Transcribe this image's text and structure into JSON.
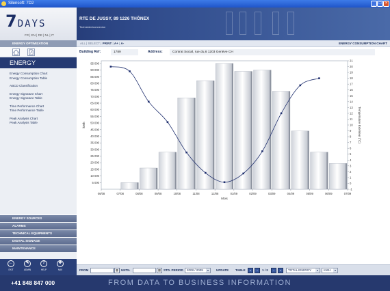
{
  "window": {
    "title": "Silensoft: 7D2"
  },
  "header": {
    "logo_main": "7",
    "logo_days": "DAYS",
    "languages": "FR | EN | DE | NL | IT",
    "address": "RTE DE JUSSY, 89 1226 THÔNEX",
    "subtitle": "Technicien/connexion"
  },
  "toolbar": {
    "section_label": "ENERGY OPTIMIZATION",
    "all": "ALL",
    "select": "SELECT",
    "print": "PRINT",
    "font_up": "A+",
    "font_down": "A-",
    "sep": "|",
    "right_title": "ENERGY CONSUMPTION CHART"
  },
  "sidebar": {
    "title": "ENERGY",
    "menu": [
      {
        "label": "Energy Consumption Chart",
        "gap_after": false
      },
      {
        "label": "Energy Consumption Table",
        "gap_after": true
      },
      {
        "label": "ABCD Classification",
        "gap_after": true
      },
      {
        "label": "Energy Signature Chart",
        "gap_after": false
      },
      {
        "label": "Energy Signature Table",
        "gap_after": true
      },
      {
        "label": "Time Performance Chart",
        "gap_after": false
      },
      {
        "label": "Time Performance Table",
        "gap_after": true
      },
      {
        "label": "Peak Analysis Chart",
        "gap_after": false
      },
      {
        "label": "Peak Analysis Table",
        "gap_after": false
      }
    ],
    "sections": [
      "ENERGY SOURCES",
      "ALARMS",
      "TECHNICAL EQUIPMENTS",
      "DIGITAL SIGNAGE",
      "MAINTENANCE"
    ],
    "nav": [
      {
        "label": "EXIT",
        "glyph": "←",
        "name": "exit-icon"
      },
      {
        "label": "ADMIN",
        "glyph": "✎",
        "name": "admin-icon"
      },
      {
        "label": "HELP",
        "glyph": "?",
        "name": "help-icon"
      },
      {
        "label": "NAV",
        "glyph": "✥",
        "name": "nav-icon"
      }
    ]
  },
  "info": {
    "building_label": "Building Ref:",
    "building_value": "1789",
    "address_label": "Address:",
    "address_value": "Contrat Social, rue du,6 1203 Genève CH"
  },
  "chart_data": {
    "type": "bar",
    "categories": [
      "06/08",
      "07/08",
      "08/08",
      "09/08",
      "10/08",
      "11/08",
      "12/08",
      "01/09",
      "02/09",
      "03/09",
      "04/09",
      "05/09",
      "06/09",
      "07/09"
    ],
    "series": [
      {
        "type": "bar",
        "axis": "left",
        "values": [
          0,
          5000,
          16000,
          28000,
          69000,
          82000,
          95000,
          89000,
          90000,
          74000,
          44000,
          28000,
          19500,
          null
        ]
      },
      {
        "type": "line",
        "axis": "right",
        "values": [
          20,
          19.2,
          14,
          10.5,
          5.3,
          1.8,
          0.2,
          1.7,
          5.5,
          12,
          16.8,
          18
        ]
      }
    ],
    "xlabel": "Mois",
    "ylabel": "kWh",
    "y2label": "Température Extérieur (°C)",
    "ylim": [
      0,
      97000
    ],
    "y2lim": [
      -1,
      21
    ],
    "yticks": [
      "5 000",
      "10 000",
      "15 000",
      "20 000",
      "25 000",
      "30 000",
      "35 000",
      "40 000",
      "45 000",
      "50 000",
      "55 000",
      "60 000",
      "65 000",
      "70 000",
      "75 000",
      "80 000",
      "85 000",
      "90 000",
      "95 000"
    ],
    "y2ticks": [
      "-1",
      "0",
      "1",
      "2",
      "3",
      "4",
      "5",
      "6",
      "7",
      "8",
      "9",
      "10",
      "11",
      "12",
      "13",
      "14",
      "15",
      "16",
      "17",
      "18",
      "19",
      "20",
      "21"
    ],
    "grid": false
  },
  "bottom": {
    "from_label": "FROM",
    "until_label": "UNTIL",
    "std_period_label": "STD. PERIOD",
    "period_value": "2008 / 2009",
    "update_label": "UPDATE",
    "table_label": "TABLE",
    "page_info": "1 / 2",
    "energy_value": "TOTAL ENERGY",
    "unit_value": "KWH",
    "cal_glyph": "▦",
    "arrow_glyph": "▼"
  },
  "footer": {
    "phone": "+41 848 847 000",
    "slogan": "FROM DATA TO BUSINESS INFORMATION"
  }
}
